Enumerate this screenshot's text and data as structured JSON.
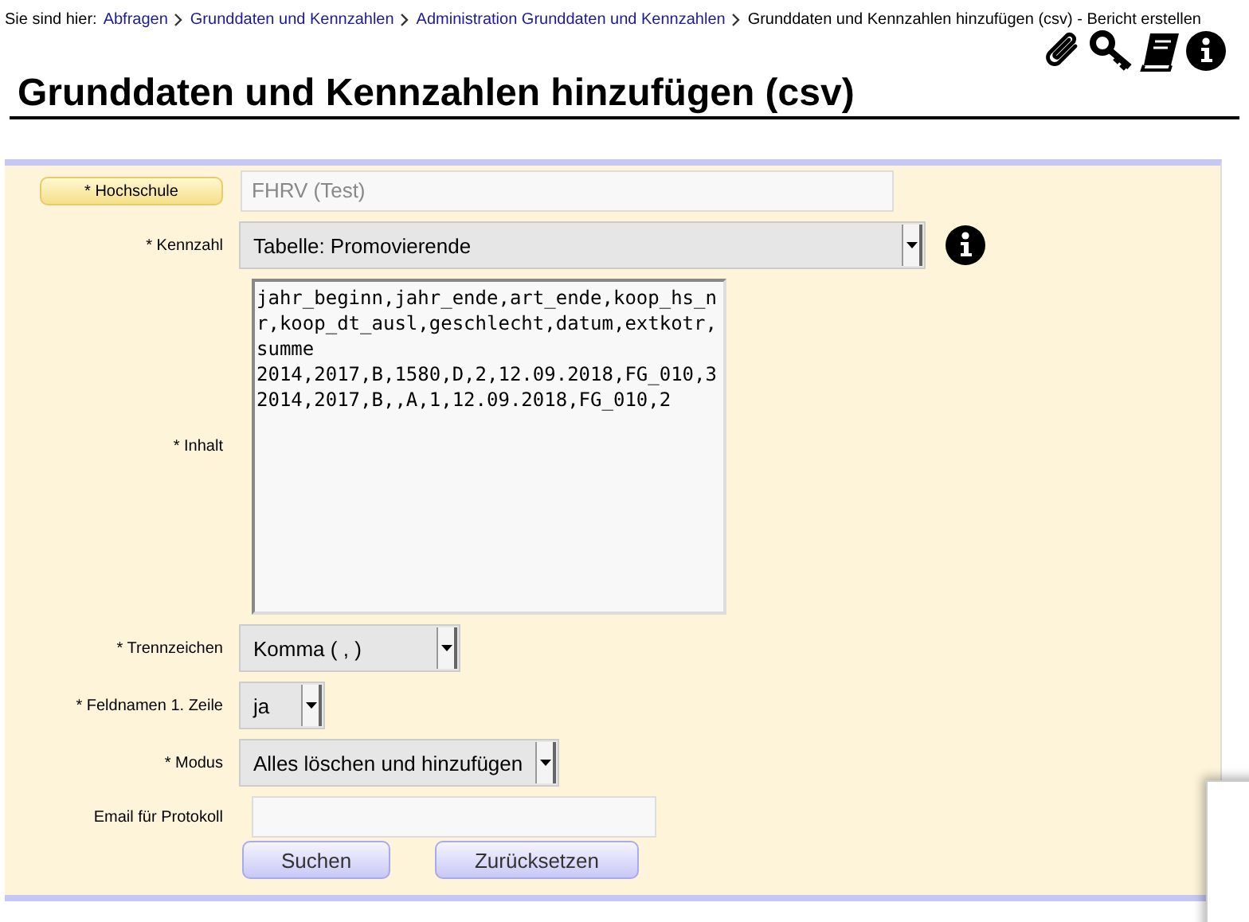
{
  "breadcrumb": {
    "prefix": "Sie sind hier:",
    "links": [
      "Abfragen",
      "Grunddaten und Kennzahlen",
      "Administration Grunddaten und Kennzahlen"
    ],
    "current": "Grunddaten und Kennzahlen hinzufügen (csv) - Bericht erstellen"
  },
  "title": "Grunddaten und Kennzahlen hinzufügen (csv)",
  "fields": [
    {
      "kind": "labelbutton",
      "label": "* Hochschule",
      "value": "FHRV (Test)",
      "disabled": true
    },
    {
      "kind": "select",
      "label": "* Kennzahl",
      "value": "Tabelle: Promovierende",
      "info": true
    },
    {
      "kind": "textarea",
      "label": "* Inhalt",
      "value": "jahr_beginn,jahr_ende,art_ende,koop_hs_nr,koop_dt_ausl,geschlecht,datum,extkotr,summe\n2014,2017,B,1580,D,2,12.09.2018,FG_010,3\n2014,2017,B,,A,1,12.09.2018,FG_010,2"
    },
    {
      "kind": "select",
      "label": "* Trennzeichen",
      "value": "Komma ( , )"
    },
    {
      "kind": "select",
      "label": "* Feldnamen 1. Zeile",
      "value": "ja"
    },
    {
      "kind": "select",
      "label": "* Modus",
      "value": "Alles löschen und hinzufügen"
    },
    {
      "kind": "input",
      "label": "Email für Protokoll"
    }
  ],
  "buttons": [
    "Suchen",
    "Zurücksetzen"
  ]
}
